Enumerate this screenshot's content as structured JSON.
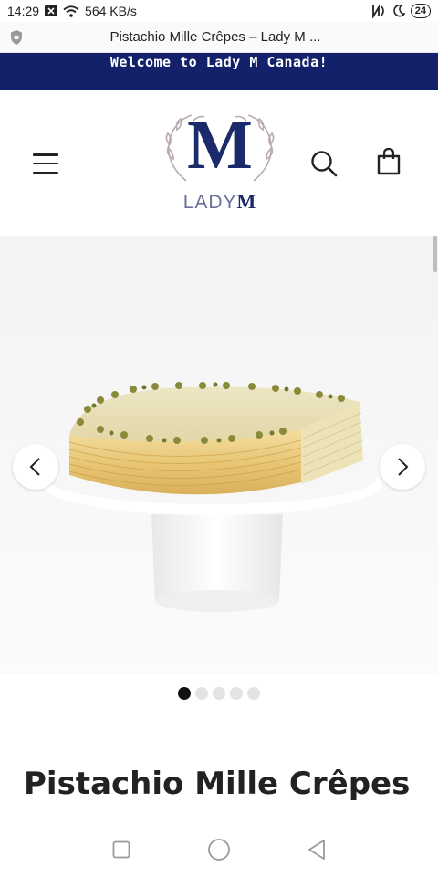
{
  "status_bar": {
    "time": "14:29",
    "network_speed": "564 KB/s",
    "battery": "24",
    "icons": [
      "notification-icon",
      "wifi-icon",
      "nfc-icon",
      "moon-icon",
      "battery-icon"
    ]
  },
  "browser": {
    "page_title": "Pistachio Mille Crêpes – Lady M ...",
    "icons": [
      "shield-icon"
    ]
  },
  "announcement": {
    "text": "Welcome to Lady M Canada!",
    "background": "#13206a"
  },
  "header": {
    "logo_letter": "M",
    "logo_word": "LADY",
    "logo_word_m": "M",
    "icons": [
      "menu-icon",
      "search-icon",
      "shopping-bag-icon"
    ]
  },
  "carousel": {
    "image": "pistachio-mille-crepes-cake-on-stand",
    "total_slides": 5,
    "active_slide": 1,
    "icons": [
      "chevron-left-icon",
      "chevron-right-icon"
    ]
  },
  "product": {
    "title": "Pistachio Mille Crêpes"
  },
  "nav_bar": {
    "icons": [
      "recent-apps-icon",
      "home-icon",
      "back-icon"
    ]
  },
  "colors": {
    "brand_navy": "#1b2a6b",
    "announce_bg": "#13206a",
    "hero_bg": "#f5f5f5"
  }
}
